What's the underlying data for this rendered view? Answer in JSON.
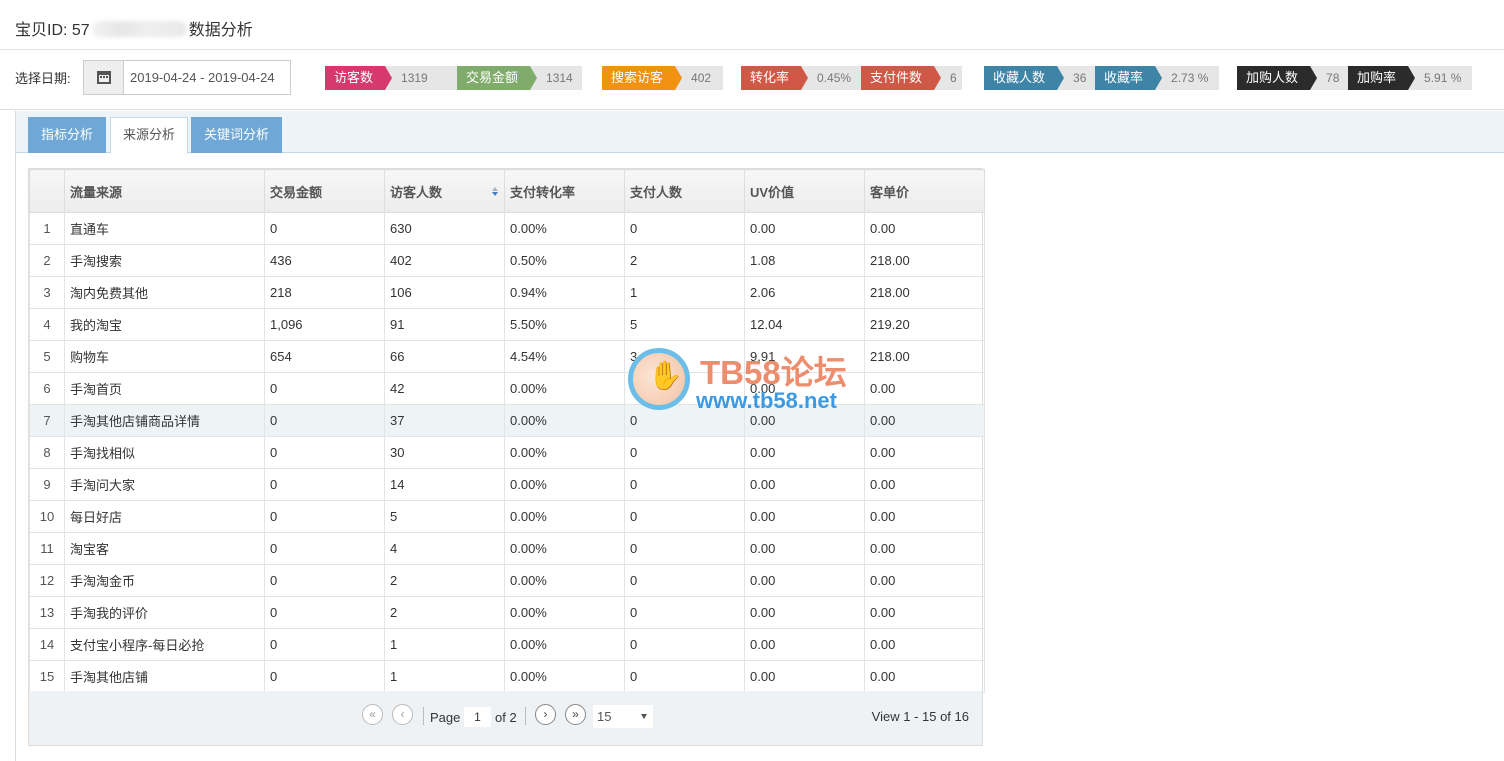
{
  "header": {
    "id_prefix": "宝贝ID: 57",
    "suffix": "数据分析"
  },
  "filter": {
    "label": "选择日期:",
    "date_range": "2019-04-24 - 2019-04-24"
  },
  "stats": [
    {
      "label": "访客数",
      "value": "1319",
      "color": "#d6396e"
    },
    {
      "label": "交易金额",
      "value": "1314",
      "color": "#7fac6a"
    },
    {
      "label": "搜索访客",
      "value": "402",
      "color": "#f29213"
    },
    {
      "label": "转化率",
      "value": "0.45%",
      "color": "#d05846"
    },
    {
      "label": "支付件数",
      "value": "6",
      "color": "#d05846"
    },
    {
      "label": "收藏人数",
      "value": "36",
      "color": "#3e84a7"
    },
    {
      "label": "收藏率",
      "value": "2.73 %",
      "color": "#3e84a7"
    },
    {
      "label": "加购人数",
      "value": "78",
      "color": "#2b2b2b"
    },
    {
      "label": "加购率",
      "value": "5.91 %",
      "color": "#2b2b2b"
    }
  ],
  "tabs": [
    {
      "label": "指标分析",
      "active": false
    },
    {
      "label": "来源分析",
      "active": true
    },
    {
      "label": "关键词分析",
      "active": false
    }
  ],
  "table": {
    "columns": [
      "流量来源",
      "交易金额",
      "访客人数",
      "支付转化率",
      "支付人数",
      "UV价值",
      "客单价"
    ],
    "rows": [
      [
        "1",
        "直通车",
        "0",
        "630",
        "0.00%",
        "0",
        "0.00",
        "0.00"
      ],
      [
        "2",
        "手淘搜索",
        "436",
        "402",
        "0.50%",
        "2",
        "1.08",
        "218.00"
      ],
      [
        "3",
        "淘内免费其他",
        "218",
        "106",
        "0.94%",
        "1",
        "2.06",
        "218.00"
      ],
      [
        "4",
        "我的淘宝",
        "1,096",
        "91",
        "5.50%",
        "5",
        "12.04",
        "219.20"
      ],
      [
        "5",
        "购物车",
        "654",
        "66",
        "4.54%",
        "3",
        "9.91",
        "218.00"
      ],
      [
        "6",
        "手淘首页",
        "0",
        "42",
        "0.00%",
        "0",
        "0.00",
        "0.00"
      ],
      [
        "7",
        "手淘其他店铺商品详情",
        "0",
        "37",
        "0.00%",
        "0",
        "0.00",
        "0.00"
      ],
      [
        "8",
        "手淘找相似",
        "0",
        "30",
        "0.00%",
        "0",
        "0.00",
        "0.00"
      ],
      [
        "9",
        "手淘问大家",
        "0",
        "14",
        "0.00%",
        "0",
        "0.00",
        "0.00"
      ],
      [
        "10",
        "每日好店",
        "0",
        "5",
        "0.00%",
        "0",
        "0.00",
        "0.00"
      ],
      [
        "11",
        "淘宝客",
        "0",
        "4",
        "0.00%",
        "0",
        "0.00",
        "0.00"
      ],
      [
        "12",
        "手淘淘金币",
        "0",
        "2",
        "0.00%",
        "0",
        "0.00",
        "0.00"
      ],
      [
        "13",
        "手淘我的评价",
        "0",
        "2",
        "0.00%",
        "0",
        "0.00",
        "0.00"
      ],
      [
        "14",
        "支付宝小程序-每日必抢",
        "0",
        "1",
        "0.00%",
        "0",
        "0.00",
        "0.00"
      ],
      [
        "15",
        "手淘其他店铺",
        "0",
        "1",
        "0.00%",
        "0",
        "0.00",
        "0.00"
      ]
    ]
  },
  "pager": {
    "page_label": "Page",
    "current_page": "1",
    "of_label": "of 2",
    "page_size": "15",
    "view_text": "View 1 - 15 of 16"
  },
  "watermark": {
    "title": "TB58论坛",
    "url": "www.tb58.net"
  }
}
